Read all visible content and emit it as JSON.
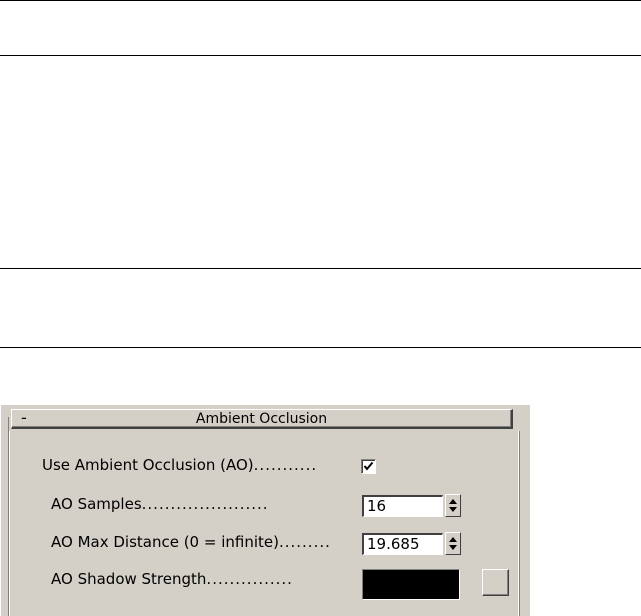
{
  "rollout": {
    "collapse_symbol": "-",
    "title": "Ambient Occlusion"
  },
  "use_ao": {
    "label": "Use Ambient Occlusion (AO)",
    "dots": "...........",
    "checked": true
  },
  "ao_samples": {
    "label": "AO Samples",
    "dots": "......................",
    "value": "16"
  },
  "ao_max_distance": {
    "label": "AO Max Distance (0 = infinite)",
    "dots": ".........",
    "value": "19.685"
  },
  "ao_shadow_strength": {
    "label": "AO Shadow Strength",
    "dots": "...............",
    "color": "#000000"
  },
  "icons": {
    "checkmark": "check-icon",
    "spinner_up": "arrow-up-icon",
    "spinner_down": "arrow-down-icon"
  }
}
